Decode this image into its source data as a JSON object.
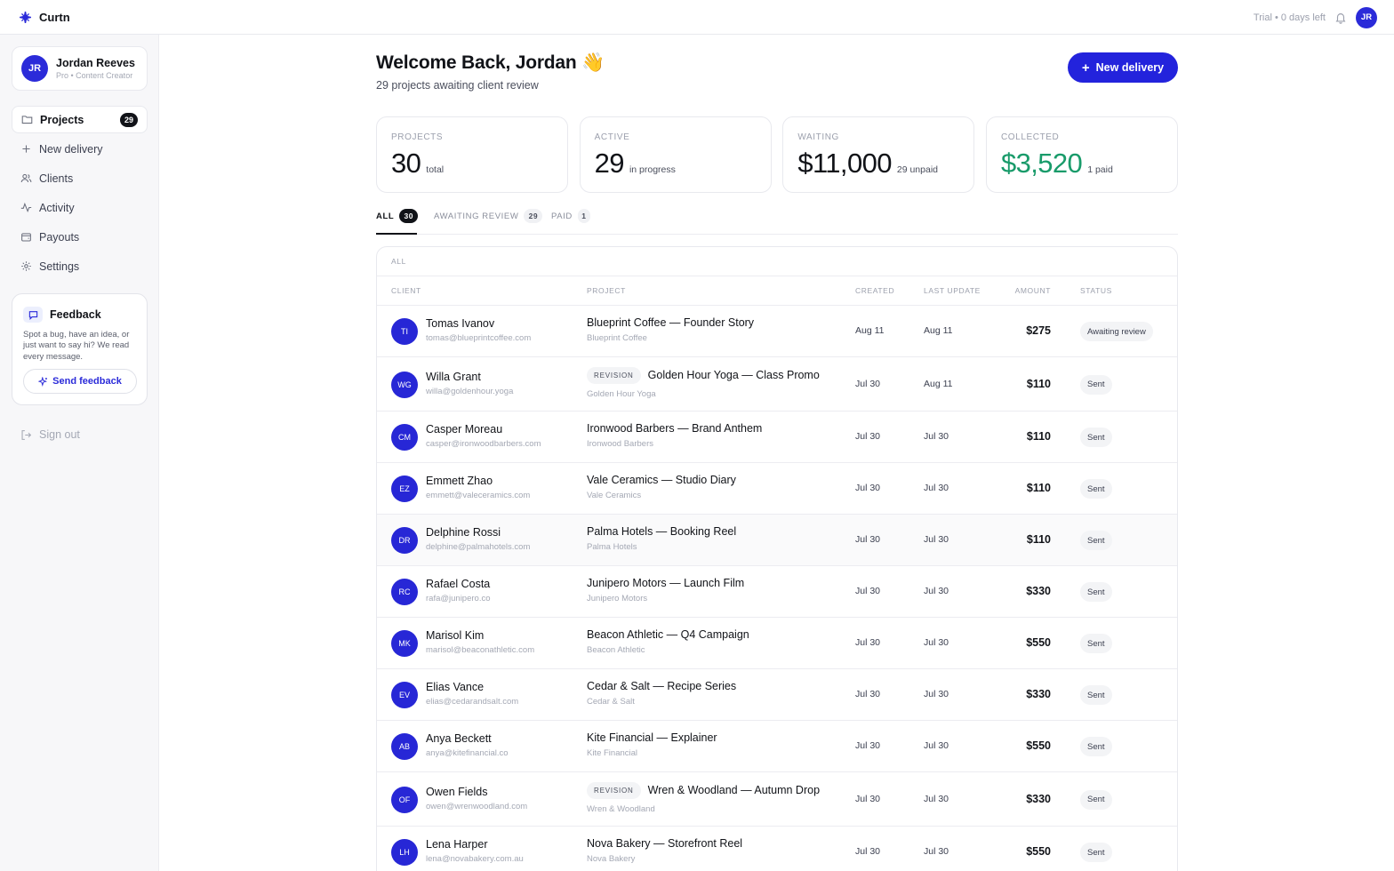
{
  "app": {
    "name": "Curtn"
  },
  "topbar": {
    "trial": "Trial • 0 days left",
    "avatar_initials": "JR"
  },
  "user": {
    "initials": "JR",
    "name": "Jordan Reeves",
    "role": "Pro • Content Creator"
  },
  "nav": [
    {
      "label": "Projects",
      "icon": "folder-icon",
      "count": "29",
      "active": true
    },
    {
      "label": "New delivery",
      "icon": "plus-icon"
    },
    {
      "label": "Clients",
      "icon": "users-icon"
    },
    {
      "label": "Activity",
      "icon": "activity-icon"
    },
    {
      "label": "Payouts",
      "icon": "wallet-icon"
    },
    {
      "label": "Settings",
      "icon": "gear-icon"
    }
  ],
  "feedback": {
    "title": "Feedback",
    "text": "Spot a bug, have an idea, or just want to say hi? We read every message.",
    "button": "Send feedback"
  },
  "signout": "Sign out",
  "header": {
    "welcome": "Welcome Back, Jordan 👋",
    "subtitle": "29 projects awaiting client review",
    "new_button": "New delivery"
  },
  "stats": [
    {
      "label": "PROJECTS",
      "value": "30",
      "unit": "total"
    },
    {
      "label": "ACTIVE",
      "value": "29",
      "unit": "in progress"
    },
    {
      "label": "WAITING",
      "value": "$11,000",
      "unit": "29 unpaid"
    },
    {
      "label": "COLLECTED",
      "value": "$3,520",
      "unit": "1 paid",
      "accent": "#199b6a"
    }
  ],
  "tabs": [
    {
      "label": "ALL",
      "count": "30",
      "active": true
    },
    {
      "label": "AWAITING REVIEW",
      "count": "29"
    },
    {
      "label": "PAID",
      "count": "1"
    }
  ],
  "table": {
    "caption": "ALL",
    "columns": [
      "CLIENT",
      "PROJECT",
      "CREATED",
      "LAST UPDATE",
      "AMOUNT",
      "STATUS"
    ],
    "rows": [
      {
        "initials": "TI",
        "name": "Tomas Ivanov",
        "email": "tomas@blueprintcoffee.com",
        "project": "Blueprint Coffee — Founder Story",
        "org": "Blueprint Coffee",
        "created": "Aug 11",
        "updated": "Aug 11",
        "amount": "$275",
        "status": "Awaiting review"
      },
      {
        "initials": "WG",
        "name": "Willa Grant",
        "email": "willa@goldenhour.yoga",
        "revision": "REVISION",
        "project": "Golden Hour Yoga — Class Promo",
        "org": "Golden Hour Yoga",
        "created": "Jul 30",
        "updated": "Aug 11",
        "amount": "$110",
        "status": "Sent"
      },
      {
        "initials": "CM",
        "name": "Casper Moreau",
        "email": "casper@ironwoodbarbers.com",
        "project": "Ironwood Barbers — Brand Anthem",
        "org": "Ironwood Barbers",
        "created": "Jul 30",
        "updated": "Jul 30",
        "amount": "$110",
        "status": "Sent"
      },
      {
        "initials": "EZ",
        "name": "Emmett Zhao",
        "email": "emmett@valeceramics.com",
        "project": "Vale Ceramics — Studio Diary",
        "org": "Vale Ceramics",
        "created": "Jul 30",
        "updated": "Jul 30",
        "amount": "$110",
        "status": "Sent"
      },
      {
        "initials": "DR",
        "name": "Delphine Rossi",
        "email": "delphine@palmahotels.com",
        "project": "Palma Hotels — Booking Reel",
        "org": "Palma Hotels",
        "created": "Jul 30",
        "updated": "Jul 30",
        "amount": "$110",
        "status": "Sent",
        "hover": true
      },
      {
        "initials": "RC",
        "name": "Rafael Costa",
        "email": "rafa@junipero.co",
        "project": "Junipero Motors — Launch Film",
        "org": "Junipero Motors",
        "created": "Jul 30",
        "updated": "Jul 30",
        "amount": "$330",
        "status": "Sent"
      },
      {
        "initials": "MK",
        "name": "Marisol Kim",
        "email": "marisol@beaconathletic.com",
        "project": "Beacon Athletic — Q4 Campaign",
        "org": "Beacon Athletic",
        "created": "Jul 30",
        "updated": "Jul 30",
        "amount": "$550",
        "status": "Sent"
      },
      {
        "initials": "EV",
        "name": "Elias Vance",
        "email": "elias@cedarandsalt.com",
        "project": "Cedar & Salt — Recipe Series",
        "org": "Cedar & Salt",
        "created": "Jul 30",
        "updated": "Jul 30",
        "amount": "$330",
        "status": "Sent"
      },
      {
        "initials": "AB",
        "name": "Anya Beckett",
        "email": "anya@kitefinancial.co",
        "project": "Kite Financial — Explainer",
        "org": "Kite Financial",
        "created": "Jul 30",
        "updated": "Jul 30",
        "amount": "$550",
        "status": "Sent"
      },
      {
        "initials": "OF",
        "name": "Owen Fields",
        "email": "owen@wrenwoodland.com",
        "revision": "REVISION",
        "project": "Wren & Woodland — Autumn Drop",
        "org": "Wren & Woodland",
        "created": "Jul 30",
        "updated": "Jul 30",
        "amount": "$330",
        "status": "Sent"
      },
      {
        "initials": "LH",
        "name": "Lena Harper",
        "email": "lena@novabakery.com.au",
        "project": "Nova Bakery — Storefront Reel",
        "org": "Nova Bakery",
        "created": "Jul 30",
        "updated": "Jul 30",
        "amount": "$550",
        "status": "Sent"
      }
    ]
  }
}
